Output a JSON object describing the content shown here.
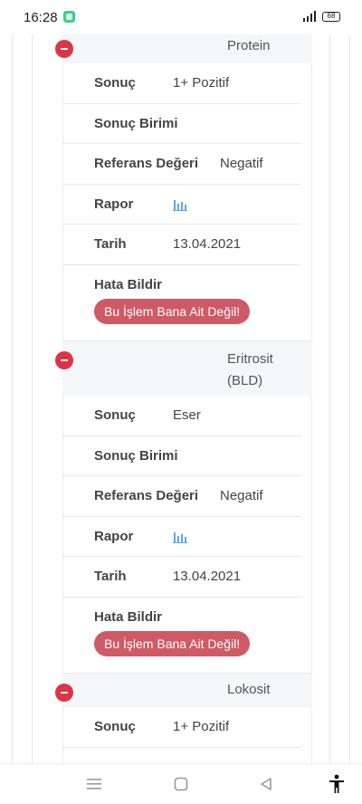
{
  "status": {
    "time": "16:28",
    "battery": "68"
  },
  "records": [
    {
      "title_lines": [
        "Protein"
      ],
      "rows": [
        {
          "label": "Sonuç",
          "value": "1+ Pozitif"
        },
        {
          "label": "Sonuç Birimi",
          "value": ""
        },
        {
          "label": "Referans Değeri",
          "value": "Negatif"
        },
        {
          "label": "Rapor",
          "icon": "bar-chart-icon"
        },
        {
          "label": "Tarih",
          "value": "13.04.2021"
        }
      ],
      "error_label": "Hata Bildir",
      "error_button": "Bu İşlem Bana Ait Değil!"
    },
    {
      "title_lines": [
        "Eritrosit",
        "(BLD)"
      ],
      "rows": [
        {
          "label": "Sonuç",
          "value": "Eser"
        },
        {
          "label": "Sonuç Birimi",
          "value": ""
        },
        {
          "label": "Referans Değeri",
          "value": "Negatif"
        },
        {
          "label": "Rapor",
          "icon": "bar-chart-icon"
        },
        {
          "label": "Tarih",
          "value": "13.04.2021"
        }
      ],
      "error_label": "Hata Bildir",
      "error_button": "Bu İşlem Bana Ait Değil!"
    },
    {
      "title_lines": [
        "Lokosit"
      ],
      "rows": [
        {
          "label": "Sonuç",
          "value": "1+ Pozitif"
        }
      ]
    }
  ],
  "nav": {
    "menu_icon": "menu-icon",
    "home_icon": "home-square-icon",
    "back_icon": "back-triangle-icon",
    "accessibility_icon": "accessibility-icon"
  },
  "colors": {
    "danger": "#dc3545",
    "error_button": "#cf5a66",
    "chart_icon": "#5aa9e6"
  }
}
